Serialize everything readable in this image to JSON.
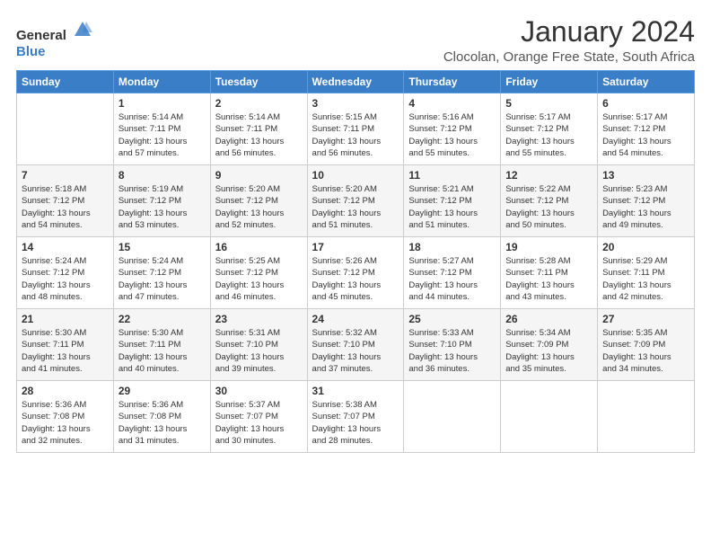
{
  "logo": {
    "general": "General",
    "blue": "Blue"
  },
  "title": "January 2024",
  "location": "Clocolan, Orange Free State, South Africa",
  "days_header": [
    "Sunday",
    "Monday",
    "Tuesday",
    "Wednesday",
    "Thursday",
    "Friday",
    "Saturday"
  ],
  "weeks": [
    [
      {
        "day": "",
        "info": ""
      },
      {
        "day": "1",
        "info": "Sunrise: 5:14 AM\nSunset: 7:11 PM\nDaylight: 13 hours\nand 57 minutes."
      },
      {
        "day": "2",
        "info": "Sunrise: 5:14 AM\nSunset: 7:11 PM\nDaylight: 13 hours\nand 56 minutes."
      },
      {
        "day": "3",
        "info": "Sunrise: 5:15 AM\nSunset: 7:11 PM\nDaylight: 13 hours\nand 56 minutes."
      },
      {
        "day": "4",
        "info": "Sunrise: 5:16 AM\nSunset: 7:12 PM\nDaylight: 13 hours\nand 55 minutes."
      },
      {
        "day": "5",
        "info": "Sunrise: 5:17 AM\nSunset: 7:12 PM\nDaylight: 13 hours\nand 55 minutes."
      },
      {
        "day": "6",
        "info": "Sunrise: 5:17 AM\nSunset: 7:12 PM\nDaylight: 13 hours\nand 54 minutes."
      }
    ],
    [
      {
        "day": "7",
        "info": "Sunrise: 5:18 AM\nSunset: 7:12 PM\nDaylight: 13 hours\nand 54 minutes."
      },
      {
        "day": "8",
        "info": "Sunrise: 5:19 AM\nSunset: 7:12 PM\nDaylight: 13 hours\nand 53 minutes."
      },
      {
        "day": "9",
        "info": "Sunrise: 5:20 AM\nSunset: 7:12 PM\nDaylight: 13 hours\nand 52 minutes."
      },
      {
        "day": "10",
        "info": "Sunrise: 5:20 AM\nSunset: 7:12 PM\nDaylight: 13 hours\nand 51 minutes."
      },
      {
        "day": "11",
        "info": "Sunrise: 5:21 AM\nSunset: 7:12 PM\nDaylight: 13 hours\nand 51 minutes."
      },
      {
        "day": "12",
        "info": "Sunrise: 5:22 AM\nSunset: 7:12 PM\nDaylight: 13 hours\nand 50 minutes."
      },
      {
        "day": "13",
        "info": "Sunrise: 5:23 AM\nSunset: 7:12 PM\nDaylight: 13 hours\nand 49 minutes."
      }
    ],
    [
      {
        "day": "14",
        "info": "Sunrise: 5:24 AM\nSunset: 7:12 PM\nDaylight: 13 hours\nand 48 minutes."
      },
      {
        "day": "15",
        "info": "Sunrise: 5:24 AM\nSunset: 7:12 PM\nDaylight: 13 hours\nand 47 minutes."
      },
      {
        "day": "16",
        "info": "Sunrise: 5:25 AM\nSunset: 7:12 PM\nDaylight: 13 hours\nand 46 minutes."
      },
      {
        "day": "17",
        "info": "Sunrise: 5:26 AM\nSunset: 7:12 PM\nDaylight: 13 hours\nand 45 minutes."
      },
      {
        "day": "18",
        "info": "Sunrise: 5:27 AM\nSunset: 7:12 PM\nDaylight: 13 hours\nand 44 minutes."
      },
      {
        "day": "19",
        "info": "Sunrise: 5:28 AM\nSunset: 7:11 PM\nDaylight: 13 hours\nand 43 minutes."
      },
      {
        "day": "20",
        "info": "Sunrise: 5:29 AM\nSunset: 7:11 PM\nDaylight: 13 hours\nand 42 minutes."
      }
    ],
    [
      {
        "day": "21",
        "info": "Sunrise: 5:30 AM\nSunset: 7:11 PM\nDaylight: 13 hours\nand 41 minutes."
      },
      {
        "day": "22",
        "info": "Sunrise: 5:30 AM\nSunset: 7:11 PM\nDaylight: 13 hours\nand 40 minutes."
      },
      {
        "day": "23",
        "info": "Sunrise: 5:31 AM\nSunset: 7:10 PM\nDaylight: 13 hours\nand 39 minutes."
      },
      {
        "day": "24",
        "info": "Sunrise: 5:32 AM\nSunset: 7:10 PM\nDaylight: 13 hours\nand 37 minutes."
      },
      {
        "day": "25",
        "info": "Sunrise: 5:33 AM\nSunset: 7:10 PM\nDaylight: 13 hours\nand 36 minutes."
      },
      {
        "day": "26",
        "info": "Sunrise: 5:34 AM\nSunset: 7:09 PM\nDaylight: 13 hours\nand 35 minutes."
      },
      {
        "day": "27",
        "info": "Sunrise: 5:35 AM\nSunset: 7:09 PM\nDaylight: 13 hours\nand 34 minutes."
      }
    ],
    [
      {
        "day": "28",
        "info": "Sunrise: 5:36 AM\nSunset: 7:08 PM\nDaylight: 13 hours\nand 32 minutes."
      },
      {
        "day": "29",
        "info": "Sunrise: 5:36 AM\nSunset: 7:08 PM\nDaylight: 13 hours\nand 31 minutes."
      },
      {
        "day": "30",
        "info": "Sunrise: 5:37 AM\nSunset: 7:07 PM\nDaylight: 13 hours\nand 30 minutes."
      },
      {
        "day": "31",
        "info": "Sunrise: 5:38 AM\nSunset: 7:07 PM\nDaylight: 13 hours\nand 28 minutes."
      },
      {
        "day": "",
        "info": ""
      },
      {
        "day": "",
        "info": ""
      },
      {
        "day": "",
        "info": ""
      }
    ]
  ]
}
